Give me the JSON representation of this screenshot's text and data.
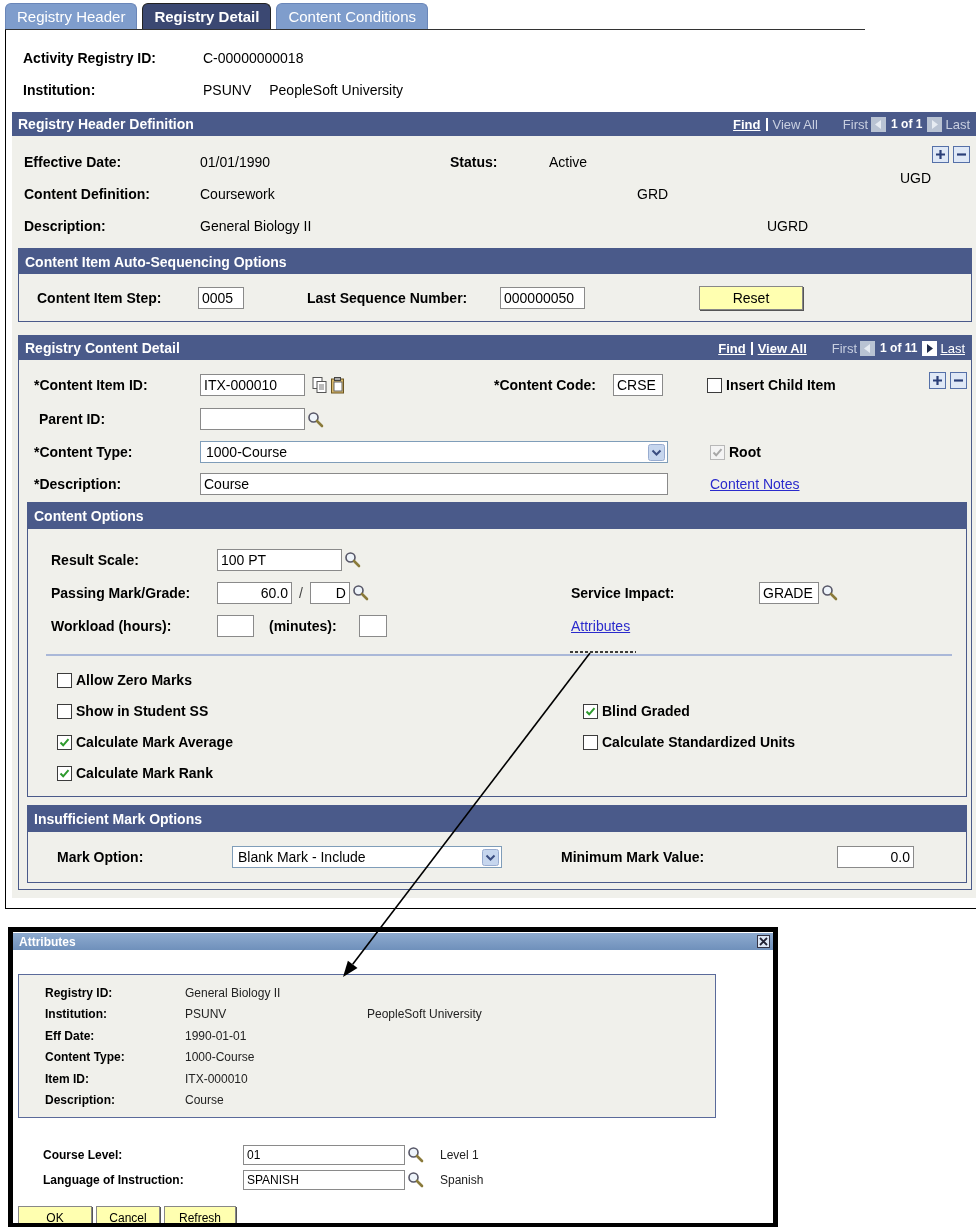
{
  "tabs": [
    {
      "label": "Registry Header",
      "selected": false
    },
    {
      "label": "Registry Detail",
      "selected": true
    },
    {
      "label": "Content Conditions",
      "selected": false
    }
  ],
  "header_fields": [
    {
      "label": "Activity Registry ID:",
      "value": "C-00000000018"
    },
    {
      "label": "Institution:",
      "value": "PSUNV",
      "value_2": "PeopleSoft University"
    }
  ],
  "registry_header_definition": {
    "title": "Registry Header Definition",
    "nav": [
      {
        "kind": "link",
        "text": "Find",
        "disabled": false
      },
      {
        "kind": "link",
        "text": "View All",
        "disabled": true
      },
      {
        "kind": "first",
        "text": "First",
        "disabled": true
      },
      {
        "kind": "count",
        "text": "1 of 1"
      },
      {
        "kind": "last",
        "text": "Last",
        "disabled": true
      }
    ],
    "rows": [
      {
        "label": "Effective Date:",
        "value": "01/01/1990",
        "label_2": "Status:",
        "value_2": "Active"
      },
      {
        "label": "Content Definition:",
        "value": "Coursework",
        "codes": [
          "GRD",
          "UGD"
        ]
      },
      {
        "label": "Description:",
        "value": "General Biology II",
        "codes": [
          "UGRD"
        ]
      }
    ],
    "auto_sequencing": {
      "title": "Content Item Auto-Sequencing Options",
      "step_label": "Content Item Step:",
      "step_value": "0005",
      "last_label": "Last Sequence Number:",
      "last_value": "000000050",
      "reset_button": "Reset"
    }
  },
  "registry_content_detail": {
    "title": "Registry Content Detail",
    "nav": [
      {
        "kind": "link",
        "text": "Find",
        "disabled": false
      },
      {
        "kind": "link",
        "text": "View All",
        "disabled": false
      },
      {
        "kind": "first",
        "text": "First",
        "disabled": true
      },
      {
        "kind": "count",
        "text": "1 of 11"
      },
      {
        "kind": "last",
        "text": "Last",
        "disabled": false
      }
    ],
    "content_item_id": {
      "label": "*Content Item ID:",
      "value": "ITX-000010"
    },
    "content_code": {
      "label": "*Content Code:",
      "value": "CRSE"
    },
    "insert_child_item": {
      "label": "Insert Child Item",
      "checked": false,
      "disabled": false
    },
    "parent_id": {
      "label": "Parent ID:"
    },
    "content_type": {
      "label": "*Content Type:",
      "value": "1000-Course"
    },
    "root": {
      "label": "Root",
      "checked": true,
      "disabled": true
    },
    "description": {
      "label": "*Description:",
      "value": "Course"
    },
    "content_notes_link": "Content Notes"
  },
  "content_options": {
    "title": "Content Options",
    "result_scale": {
      "label": "Result Scale:",
      "value": "100 PT"
    },
    "passing_mark": {
      "label": "Passing Mark/Grade:",
      "mark": "60.0",
      "separator": "/",
      "grade": "D"
    },
    "service_impact": {
      "label": "Service Impact:",
      "value": "GRADE"
    },
    "workload": {
      "hours_label": "Workload (hours):",
      "minutes_label": "(minutes):"
    },
    "attributes_link": "Attributes",
    "left_checkboxes": [
      {
        "label": "Allow Zero Marks",
        "checked": false
      },
      {
        "label": "Show in Student SS",
        "checked": false
      },
      {
        "label": "Calculate Mark Average",
        "checked": true
      },
      {
        "label": "Calculate Mark Rank",
        "checked": true
      }
    ],
    "right_checkboxes": [
      {
        "label": "Blind Graded",
        "checked": true
      },
      {
        "label": "Calculate Standardized Units",
        "checked": false
      }
    ]
  },
  "insufficient_mark_options": {
    "title": "Insufficient Mark Options",
    "mark_option": {
      "label": "Mark Option:",
      "value": "Blank Mark - Include"
    },
    "minimum_mark_value": {
      "label": "Minimum Mark Value:",
      "value": "0.0"
    }
  },
  "attributes_dialog": {
    "title": "Attributes",
    "info": [
      {
        "label": "Registry ID:",
        "value": "General Biology II"
      },
      {
        "label": "Institution:",
        "value": "PSUNV",
        "value_2": "PeopleSoft University"
      },
      {
        "label": "Eff Date:",
        "value": "1990-01-01"
      },
      {
        "label": "Content Type:",
        "value": "1000-Course"
      },
      {
        "label": "Item ID:",
        "value": "ITX-000010"
      },
      {
        "label": "Description:",
        "value": "Course"
      }
    ],
    "fields": [
      {
        "label": "Course Level:",
        "value": "01",
        "description": "Level 1"
      },
      {
        "label": "Language of Instruction:",
        "value": "SPANISH",
        "description": "Spanish"
      }
    ],
    "buttons": [
      "OK",
      "Cancel",
      "Refresh"
    ]
  }
}
